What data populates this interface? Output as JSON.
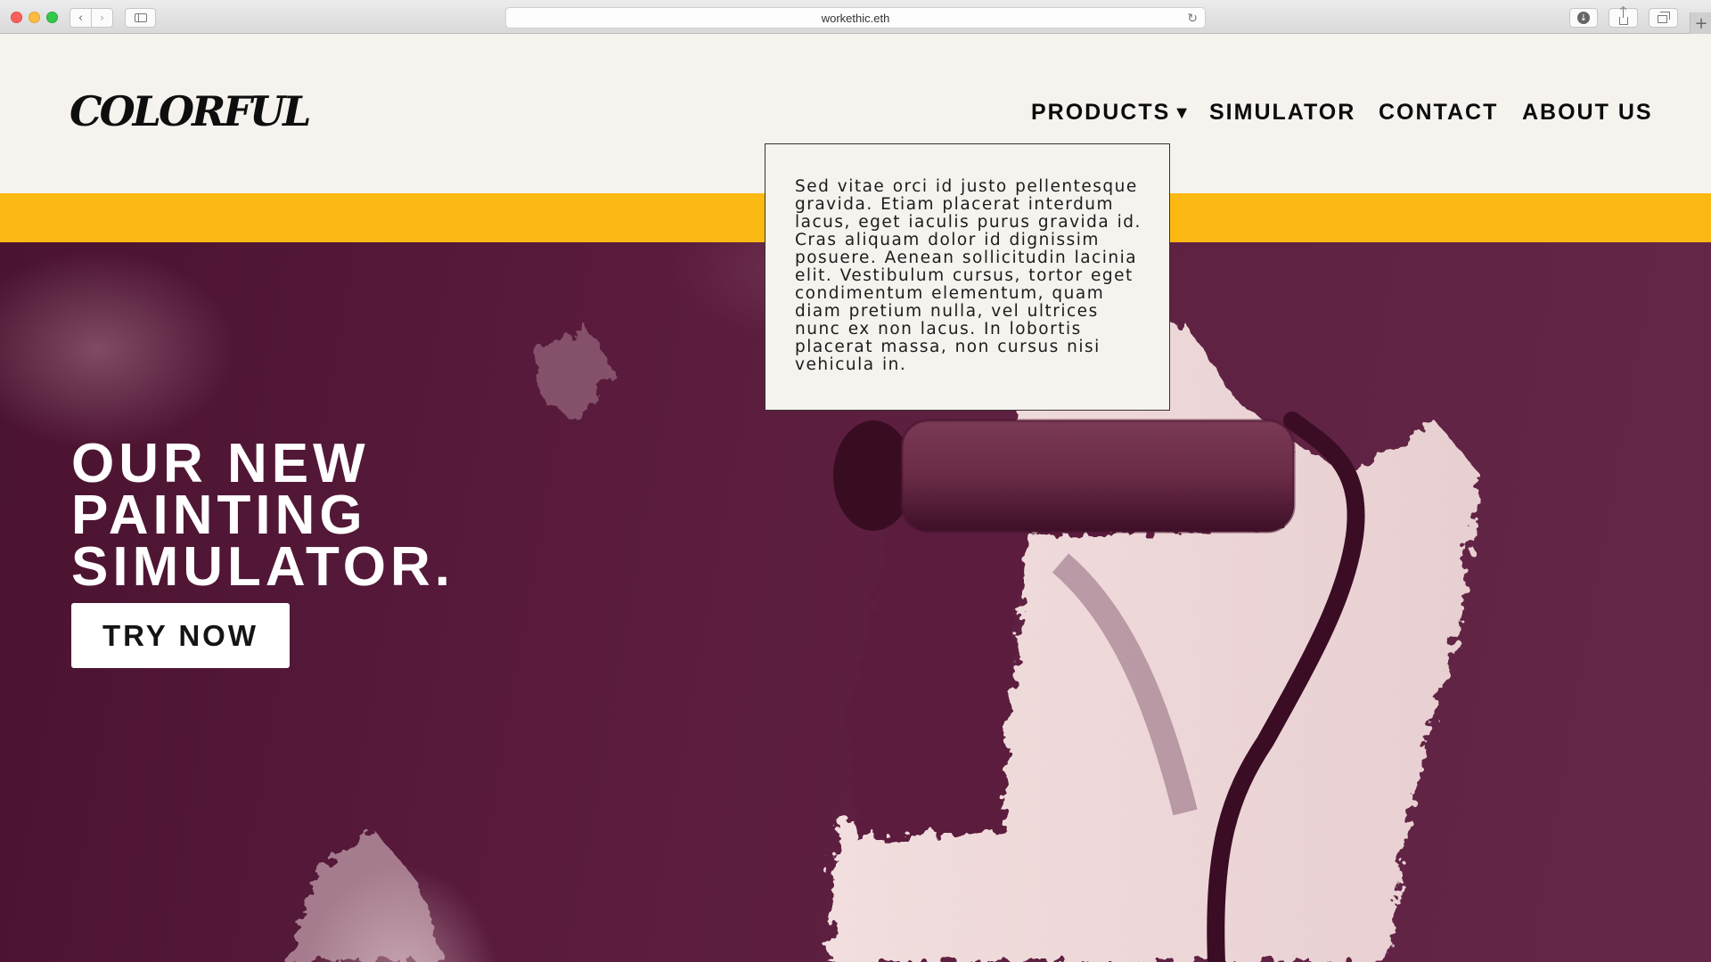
{
  "browser": {
    "url": "workethic.eth"
  },
  "site": {
    "logo": "COLORFUL",
    "nav": {
      "products": "PRODUCTS",
      "simulator": "SIMULATOR",
      "contact": "CONTACT",
      "about": "ABOUT US"
    },
    "products_dropdown": {
      "text": "Sed vitae orci id justo pellentesque gravida. Etiam placerat interdum lacus, eget iaculis purus gravida id. Cras aliquam dolor id dignissim posuere. Aenean sollicitudin lacinia elit. Vestibulum cursus, tortor eget condimentum elementum, quam diam pretium nulla, vel ultrices nunc ex non lacus. In lobortis placerat massa, non cursus nisi vehicula in."
    }
  },
  "hero": {
    "title_lines": [
      "OUR NEW",
      "PAINTING",
      "SIMULATOR."
    ],
    "cta_label": "TRY NOW"
  },
  "colors": {
    "accent_yellow": "#fdb913",
    "hero_plum": "#5a1b3c",
    "page_background": "#f6f2ee"
  },
  "icons": {
    "caret": "caret-down-icon",
    "reload": "reload-icon",
    "back": "chevron-left-icon",
    "forward": "chevron-right-icon"
  }
}
